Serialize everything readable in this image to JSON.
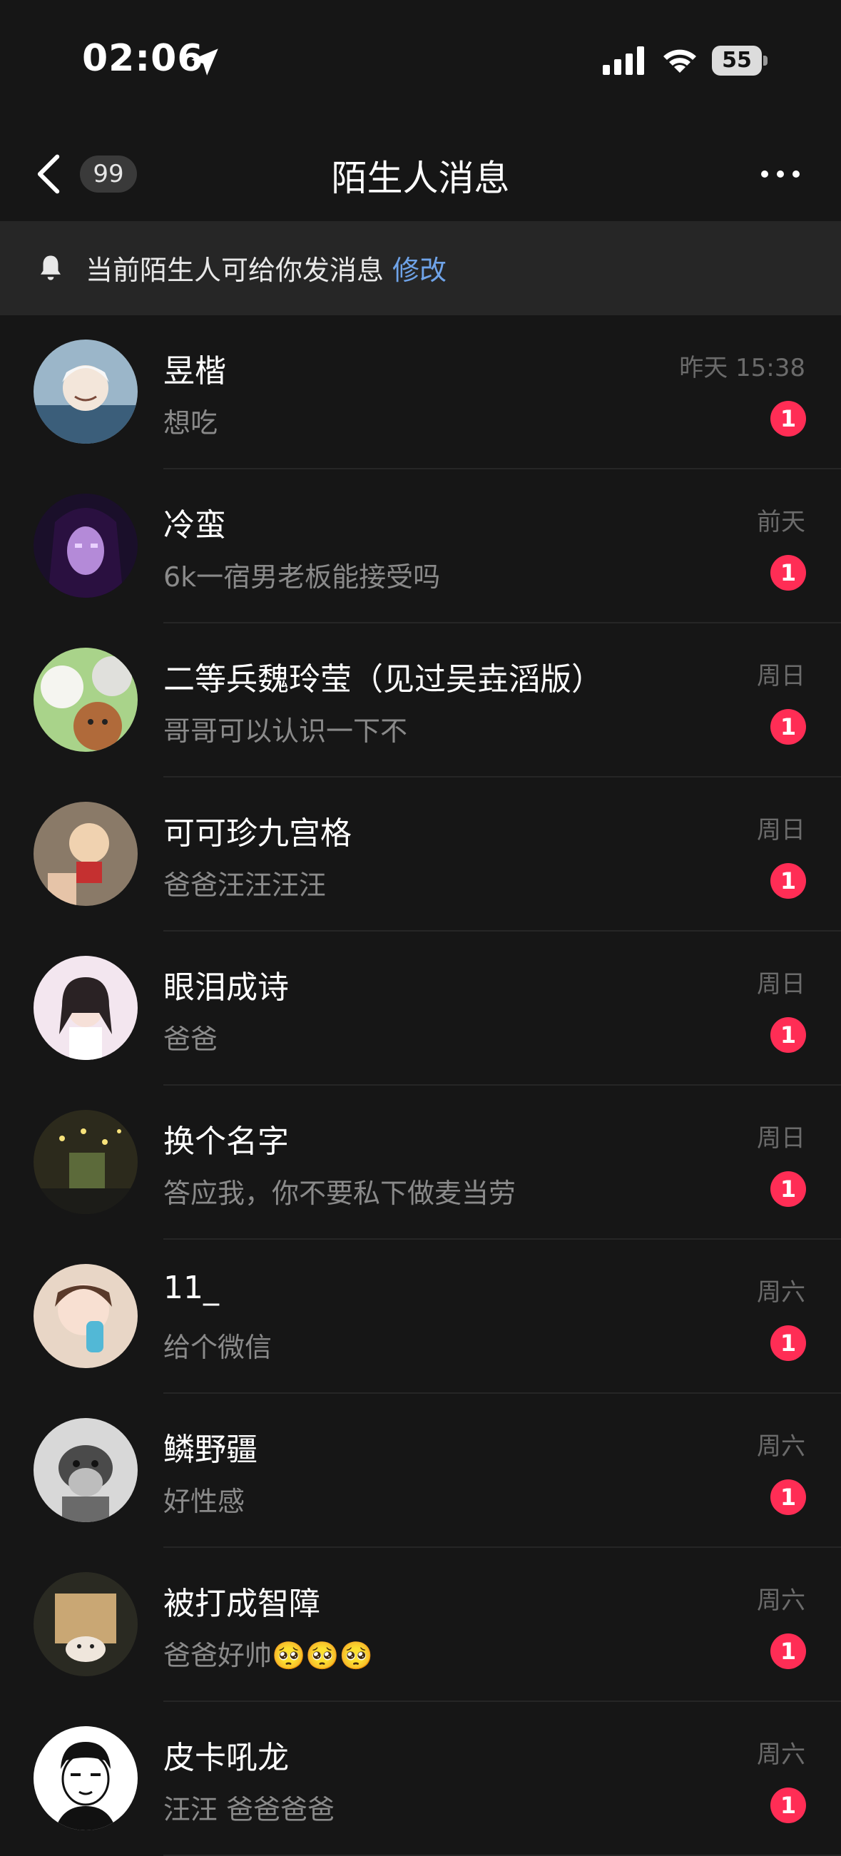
{
  "status_bar": {
    "time": "02:06",
    "battery": "55",
    "icons": [
      "location-arrow-icon",
      "cell-signal-icon",
      "wifi-icon",
      "battery-icon"
    ]
  },
  "nav": {
    "back_icon": "chevron-left-icon",
    "unread_count": "99",
    "title": "陌生人消息",
    "more_icon": "ellipsis-icon"
  },
  "notice": {
    "icon": "bell-icon",
    "text": "当前陌生人可给你发消息",
    "action": "修改"
  },
  "colors": {
    "background": "#161616",
    "notice_bg": "#262626",
    "accent_link": "#6fa3e8",
    "unread_badge": "#ff2d55"
  },
  "conversations": [
    {
      "name": "昱楷",
      "preview": "想吃",
      "time": "昨天 15:38",
      "unread": "1"
    },
    {
      "name": "冷蛮",
      "preview": "6k一宿男老板能接受吗",
      "time": "前天",
      "unread": "1"
    },
    {
      "name": "二等兵魏玲莹（见过吴垚滔版）",
      "preview": "哥哥可以认识一下不",
      "time": "周日",
      "unread": "1"
    },
    {
      "name": "可可珍九宫格",
      "preview": "爸爸汪汪汪汪",
      "time": "周日",
      "unread": "1"
    },
    {
      "name": "眼泪成诗",
      "preview": "爸爸",
      "time": "周日",
      "unread": "1"
    },
    {
      "name": "换个名字",
      "preview": "答应我，你不要私下做麦当劳",
      "time": "周日",
      "unread": "1"
    },
    {
      "name": "11_",
      "preview": "给个微信",
      "time": "周六",
      "unread": "1"
    },
    {
      "name": "鳞野疆",
      "preview": "好性感",
      "time": "周六",
      "unread": "1"
    },
    {
      "name": "被打成智障",
      "preview": "爸爸好帅🥺🥺🥺",
      "time": "周六",
      "unread": "1"
    },
    {
      "name": "皮卡吼龙",
      "preview": "汪汪 爸爸爸爸",
      "time": "周六",
      "unread": "1"
    }
  ]
}
